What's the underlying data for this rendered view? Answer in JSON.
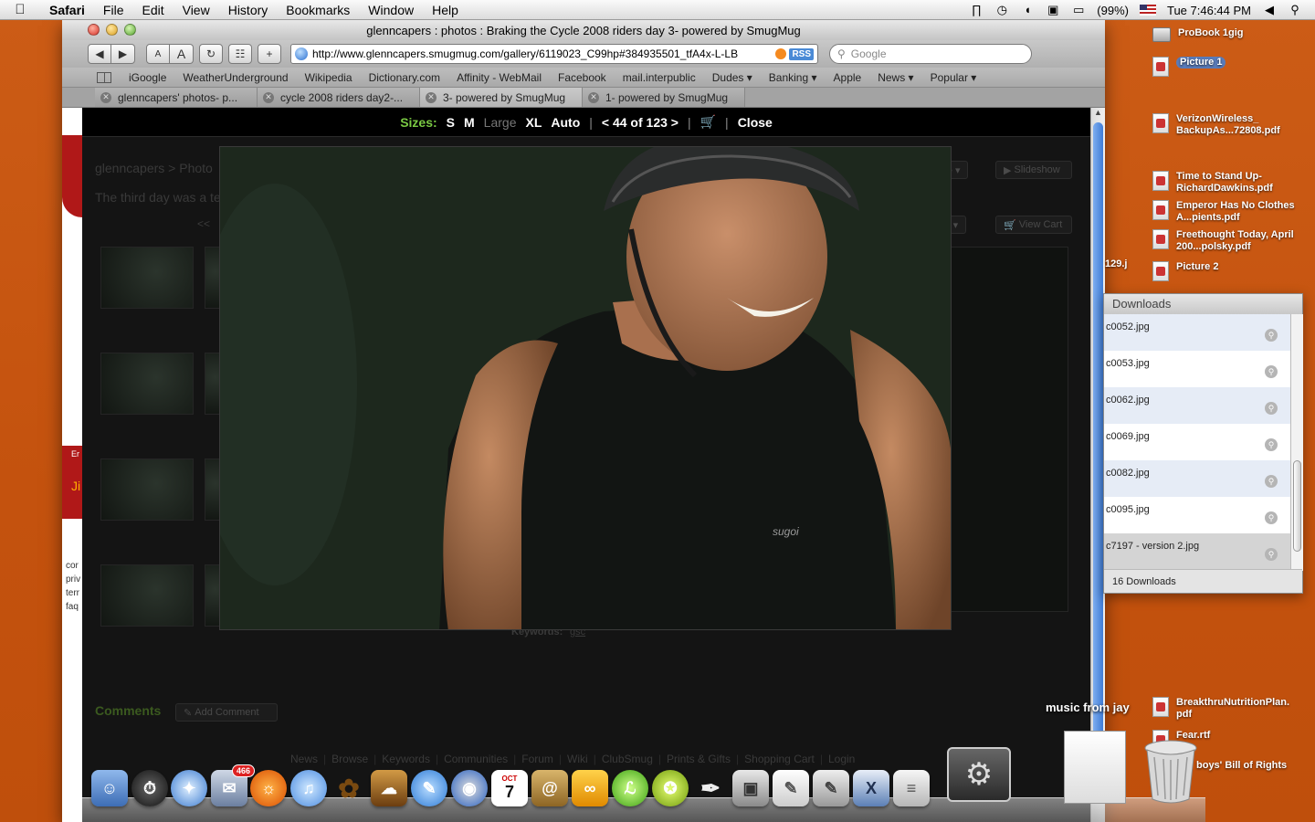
{
  "menubar": {
    "app": "Safari",
    "items": [
      "File",
      "Edit",
      "View",
      "History",
      "Bookmarks",
      "Window",
      "Help"
    ],
    "battery": "(99%)",
    "clock": "Tue 7:46:44 PM"
  },
  "window": {
    "title": "glenncapers : photos : Braking the Cycle 2008 riders day 3- powered by SmugMug",
    "url": "http://www.glenncapers.smugmug.com/gallery/6119023_C99hp#384935501_tfA4x-L-LB",
    "rss": "RSS",
    "search_placeholder": "Google",
    "toolbar": {
      "font_small": "A",
      "font_large": "A",
      "add": "+"
    },
    "bookmarks": [
      "iGoogle",
      "WeatherUnderground",
      "Wikipedia",
      "Dictionary.com",
      "Affinity - WebMail",
      "Facebook",
      "mail.interpublic",
      "Dudes ▾",
      "Banking ▾",
      "Apple",
      "News ▾",
      "Popular ▾"
    ],
    "tabs": [
      "glenncapers' photos- p...",
      "cycle 2008 riders day2-...",
      "3- powered by SmugMug",
      "1- powered by SmugMug"
    ]
  },
  "page": {
    "breadcrumb": "glenncapers  >  Photo",
    "description": "The third day was a te",
    "prev": "<<",
    "share": "are ▾",
    "slideshow": "Slideshow",
    "buy": "uy ▾",
    "view_cart": "View Cart",
    "keywords_label": "Keywords:",
    "keywords_value": "gsc",
    "comments": "Comments",
    "add_comment": "Add Comment",
    "footer_links": [
      "News",
      "Browse",
      "Keywords",
      "Communities",
      "Forum",
      "Wiki",
      "ClubSmug",
      "Prints & Gifts",
      "Shopping Cart",
      "Login"
    ],
    "side_red_text": "Er",
    "side_red_big": "Ji",
    "side_notes": [
      "cor",
      "priv",
      "terr",
      "faq"
    ]
  },
  "lightbox": {
    "sizes_label": "Sizes:",
    "sizes": [
      "S",
      "M",
      "Large",
      "XL",
      "Auto"
    ],
    "counter": "< 44 of 123 >",
    "close": "Close",
    "photo_logo": "sugoi"
  },
  "desktop_icons": [
    {
      "label": "ProBook 1gig",
      "kind": "drive"
    },
    {
      "label": "Picture 1",
      "kind": "file",
      "selected": true
    },
    {
      "label": "VerizonWireless_ BackupAs...72808.pdf",
      "kind": "file"
    },
    {
      "label": "Time to Stand Up- RichardDawkins.pdf",
      "kind": "file"
    },
    {
      "label": "Emperor Has No Clothes A...pients.pdf",
      "kind": "file"
    },
    {
      "label": "Freethought Today, April 200...polsky.pdf",
      "kind": "file"
    },
    {
      "label": "Picture 2",
      "kind": "file"
    },
    {
      "label": "BreakthruNutritionPlan. pdf",
      "kind": "file"
    },
    {
      "label": "Fear.rtf",
      "kind": "file"
    },
    {
      "label": "boys' Bill of Rights",
      "kind": "file"
    }
  ],
  "partial_desktop_label": "129.j",
  "downloads": {
    "title": "Downloads",
    "items": [
      "c0052.jpg",
      "c0053.jpg",
      "c0062.jpg",
      "c0069.jpg",
      "c0082.jpg",
      "c0095.jpg",
      "c7197 - version 2.jpg"
    ],
    "count": "16 Downloads"
  },
  "dock": {
    "music_label": "music from jay",
    "mail_badge": "466",
    "calendar_month": "OCT",
    "calendar_day": "7"
  }
}
